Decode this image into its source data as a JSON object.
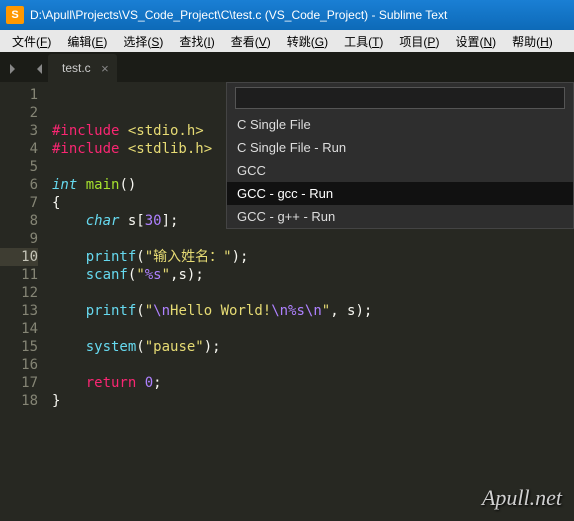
{
  "window": {
    "title": "D:\\Apull\\Projects\\VS_Code_Project\\C\\test.c (VS_Code_Project) - Sublime Text",
    "icon_letter": "S"
  },
  "menu": {
    "file": "文件(",
    "file_u": "F",
    "file2": ")",
    "edit": "编辑(",
    "edit_u": "E",
    "edit2": ")",
    "sel": "选择(",
    "sel_u": "S",
    "sel2": ")",
    "find": "查找(",
    "find_u": "I",
    "find2": ")",
    "view": "查看(",
    "view_u": "V",
    "view2": ")",
    "goto": "转跳(",
    "goto_u": "G",
    "goto2": ")",
    "tools": "工具(",
    "tools_u": "T",
    "tools2": ")",
    "proj": "项目(",
    "proj_u": "P",
    "proj2": ")",
    "pref": "设置(",
    "pref_u": "N",
    "pref2": ")",
    "help": "帮助(",
    "help_u": "H",
    "help2": ")"
  },
  "tab": {
    "name": "test.c"
  },
  "gutter": [
    "1",
    "2",
    "3",
    "4",
    "5",
    "6",
    "7",
    "8",
    "9",
    "10",
    "11",
    "12",
    "13",
    "14",
    "15",
    "16",
    "17",
    "18"
  ],
  "code": {
    "l3a": "#include ",
    "l3b": "<stdio.h>",
    "l4a": "#include ",
    "l4b": "<stdlib.h>",
    "l6a": "int",
    "l6b": " ",
    "l6c": "main",
    "l6d": "()",
    "l7": "{",
    "l8a": "    ",
    "l8b": "char",
    "l8c": " s[",
    "l8d": "30",
    "l8e": "];",
    "l10a": "    ",
    "l10b": "printf",
    "l10c": "(",
    "l10d": "\"输入姓名：\"",
    "l10e": ");",
    "l11a": "    ",
    "l11b": "scanf",
    "l11c": "(",
    "l11d": "\"",
    "l11e": "%s",
    "l11f": "\"",
    "l11g": ",s);",
    "l13a": "    ",
    "l13b": "printf",
    "l13c": "(",
    "l13d": "\"",
    "l13e": "\\n",
    "l13f": "Hello World!",
    "l13g": "\\n",
    "l13h": "%s",
    "l13i": "\\n",
    "l13j": "\"",
    "l13k": ", s);",
    "l15a": "    ",
    "l15b": "system",
    "l15c": "(",
    "l15d": "\"pause\"",
    "l15e": ");",
    "l17a": "    ",
    "l17b": "return",
    "l17c": " ",
    "l17d": "0",
    "l17e": ";",
    "l18": "}"
  },
  "panel": {
    "input": "",
    "items": [
      "C Single File",
      "C Single File - Run",
      "GCC",
      "GCC - gcc - Run",
      "GCC - g++ - Run"
    ]
  },
  "watermark": "Apull.net"
}
